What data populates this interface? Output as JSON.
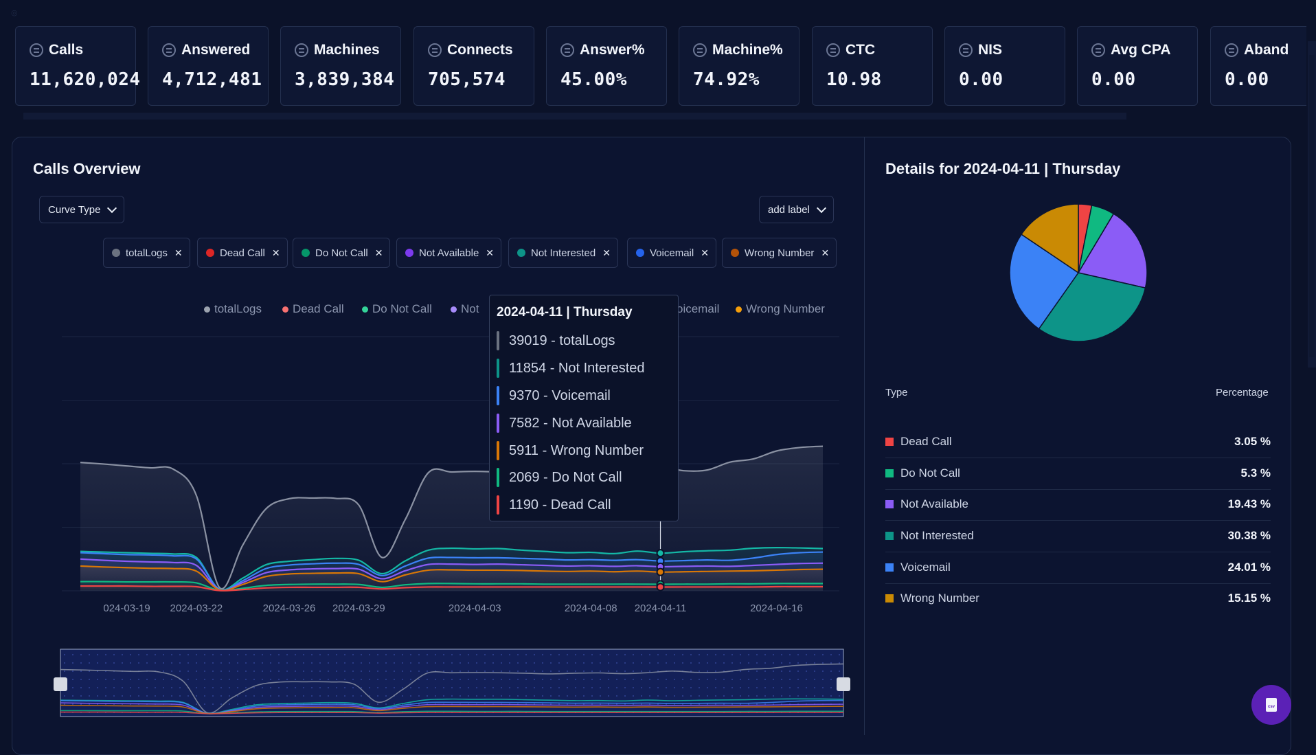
{
  "kpis": [
    {
      "label": "Calls",
      "value": "11,620,024"
    },
    {
      "label": "Answered",
      "value": "4,712,481"
    },
    {
      "label": "Machines",
      "value": "3,839,384"
    },
    {
      "label": "Connects",
      "value": "705,574"
    },
    {
      "label": "Answer%",
      "value": "45.00%"
    },
    {
      "label": "Machine%",
      "value": "74.92%"
    },
    {
      "label": "CTC",
      "value": "10.98"
    },
    {
      "label": "NIS",
      "value": "0.00"
    },
    {
      "label": "Avg CPA",
      "value": "0.00"
    },
    {
      "label": "Aband",
      "value": "0.00"
    }
  ],
  "overview": {
    "title": "Calls Overview",
    "curve_type_label": "Curve Type",
    "add_label": "add label"
  },
  "chips": [
    {
      "label": "totalLogs",
      "color": "#6b7280"
    },
    {
      "label": "Dead Call",
      "color": "#dc2626"
    },
    {
      "label": "Do Not Call",
      "color": "#059669"
    },
    {
      "label": "Not Available",
      "color": "#7c3aed"
    },
    {
      "label": "Not Interested",
      "color": "#0d9488"
    },
    {
      "label": "Voicemail",
      "color": "#2563eb"
    },
    {
      "label": "Wrong Number",
      "color": "#b45309"
    }
  ],
  "legend": [
    {
      "label": "totalLogs",
      "color": "#9ca3af"
    },
    {
      "label": "Dead Call",
      "color": "#f87171"
    },
    {
      "label": "Do Not Call",
      "color": "#34d399"
    },
    {
      "label": "Not",
      "color": "#a78bfa"
    },
    {
      "label": "oicemail",
      "color": "#60a5fa"
    },
    {
      "label": "Wrong Number",
      "color": "#f59e0b"
    }
  ],
  "tooltip": {
    "title": "2024-04-11 | Thursday",
    "rows": [
      {
        "text": "39019 - totalLogs",
        "color": "#6b7280"
      },
      {
        "text": "11854 - Not Interested",
        "color": "#0d9488"
      },
      {
        "text": "9370 - Voicemail",
        "color": "#3b82f6"
      },
      {
        "text": "7582 - Not Available",
        "color": "#8b5cf6"
      },
      {
        "text": "5911 - Wrong Number",
        "color": "#d97706"
      },
      {
        "text": "2069 - Do Not Call",
        "color": "#10b981"
      },
      {
        "text": "1190 - Dead Call",
        "color": "#ef4444"
      }
    ]
  },
  "chart_data": {
    "type": "area",
    "x_tick_labels": [
      "024-03-19",
      "2024-03-22",
      "2024-03-26",
      "2024-03-29",
      "2024-04-03",
      "2024-04-08",
      "2024-04-11",
      "2024-04-16"
    ],
    "x": [
      "2024-03-17",
      "2024-03-18",
      "2024-03-19",
      "2024-03-20",
      "2024-03-21",
      "2024-03-22",
      "2024-03-23",
      "2024-03-24",
      "2024-03-25",
      "2024-03-26",
      "2024-03-27",
      "2024-03-28",
      "2024-03-29",
      "2024-03-30",
      "2024-03-31",
      "2024-04-01",
      "2024-04-02",
      "2024-04-03",
      "2024-04-04",
      "2024-04-05",
      "2024-04-06",
      "2024-04-07",
      "2024-04-08",
      "2024-04-09",
      "2024-04-10",
      "2024-04-11",
      "2024-04-12",
      "2024-04-13",
      "2024-04-14",
      "2024-04-15",
      "2024-04-16",
      "2024-04-17",
      "2024-04-18"
    ],
    "ylim": [
      0,
      80000
    ],
    "series": [
      {
        "name": "totalLogs",
        "color": "#8b92a3",
        "values": [
          40400,
          39900,
          39300,
          38700,
          38300,
          30000,
          1000,
          14400,
          25800,
          29000,
          29200,
          29100,
          27000,
          10500,
          22400,
          37200,
          37400,
          37600,
          37400,
          37000,
          36400,
          37000,
          37300,
          36600,
          37500,
          39000,
          37800,
          38000,
          40500,
          41500,
          44000,
          45100,
          45500
        ]
      },
      {
        "name": "Not Interested",
        "color": "#14b8a6",
        "values": [
          12400,
          12200,
          12000,
          11800,
          11600,
          10500,
          500,
          4000,
          8200,
          9300,
          9800,
          10200,
          9600,
          5400,
          9400,
          12800,
          13400,
          13200,
          13300,
          12800,
          12400,
          12000,
          12100,
          11700,
          12500,
          11854,
          12300,
          12600,
          12800,
          13400,
          13600,
          13500,
          13300
        ]
      },
      {
        "name": "Voicemail",
        "color": "#3b82f6",
        "values": [
          12000,
          11700,
          11400,
          11300,
          11000,
          10000,
          400,
          3200,
          7000,
          8100,
          8500,
          8700,
          8300,
          4800,
          7800,
          10300,
          10500,
          10400,
          10400,
          10200,
          10000,
          9700,
          9800,
          9600,
          9800,
          9370,
          9500,
          9700,
          9600,
          10300,
          11400,
          12000,
          12200
        ]
      },
      {
        "name": "Not Available",
        "color": "#8b5cf6",
        "values": [
          10000,
          9600,
          9300,
          9100,
          8900,
          8000,
          300,
          2600,
          5700,
          6600,
          6900,
          7000,
          6800,
          3800,
          6300,
          8300,
          8400,
          8300,
          8400,
          8200,
          8000,
          7800,
          7900,
          7700,
          7900,
          7582,
          7700,
          7800,
          7700,
          8000,
          8300,
          8600,
          8700
        ]
      },
      {
        "name": "Wrong Number",
        "color": "#d97706",
        "values": [
          7800,
          7500,
          7300,
          7100,
          7000,
          6200,
          250,
          2000,
          4500,
          5300,
          5500,
          5600,
          5400,
          2900,
          5000,
          6500,
          6600,
          6500,
          6500,
          6400,
          6200,
          6100,
          6200,
          6000,
          6200,
          5911,
          6000,
          6100,
          6200,
          6300,
          6500,
          6700,
          6800
        ]
      },
      {
        "name": "Do Not Call",
        "color": "#10b981",
        "values": [
          2900,
          2900,
          2800,
          2800,
          2800,
          2500,
          100,
          800,
          1700,
          2000,
          2100,
          2100,
          2000,
          1100,
          1900,
          2300,
          2300,
          2200,
          2200,
          2200,
          2100,
          2100,
          2100,
          2100,
          2100,
          2069,
          2100,
          2100,
          2200,
          2200,
          2300,
          2300,
          2300
        ]
      },
      {
        "name": "Dead Call",
        "color": "#ef4444",
        "values": [
          1500,
          1500,
          1500,
          1400,
          1400,
          1300,
          80,
          400,
          900,
          1100,
          1100,
          1100,
          1100,
          600,
          1000,
          1200,
          1200,
          1200,
          1200,
          1200,
          1200,
          1200,
          1200,
          1200,
          1200,
          1190,
          1200,
          1200,
          1200,
          1200,
          1300,
          1300,
          1300
        ]
      }
    ],
    "highlight_index": 25
  },
  "details": {
    "title": "Details for 2024-04-11 | Thursday",
    "col_type": "Type",
    "col_pct": "Percentage",
    "rows": [
      {
        "name": "Dead Call",
        "pct": "3.05 %",
        "value": 3.05,
        "color": "#ef4444"
      },
      {
        "name": "Do Not Call",
        "pct": "5.3 %",
        "value": 5.3,
        "color": "#10b981"
      },
      {
        "name": "Not Available",
        "pct": "19.43 %",
        "value": 19.43,
        "color": "#8b5cf6"
      },
      {
        "name": "Not Interested",
        "pct": "30.38 %",
        "value": 30.38,
        "color": "#0d9488"
      },
      {
        "name": "Voicemail",
        "pct": "24.01 %",
        "value": 24.01,
        "color": "#3b82f6"
      },
      {
        "name": "Wrong Number",
        "pct": "15.15 %",
        "value": 15.15,
        "color": "#ca8a04"
      }
    ]
  },
  "fab": {
    "label": "csv"
  }
}
